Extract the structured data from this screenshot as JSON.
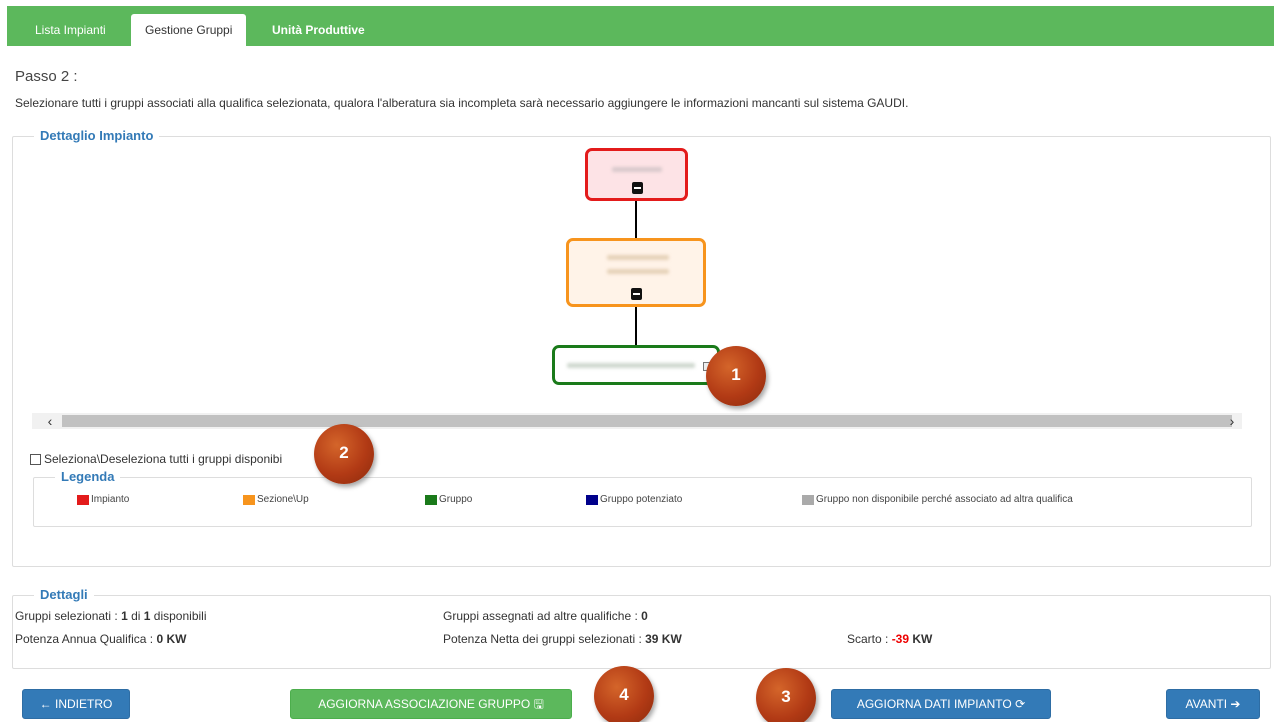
{
  "tabs": [
    {
      "label": "Lista Impianti"
    },
    {
      "label": "Gestione Gruppi"
    },
    {
      "label": "Unità Produttive"
    }
  ],
  "passo": "Passo 2 :",
  "instructions": "Selezionare tutti i gruppi associati alla qualifica selezionata, qualora l'alberatura sia incompleta sarà necessario aggiungere le informazioni mancanti sul sistema GAUDI.",
  "dettaglio_impianto": {
    "title": "Dettaglio Impianto"
  },
  "select_all": "Seleziona\\Deseleziona tutti i gruppi disponibi",
  "legenda": {
    "title": "Legenda",
    "items": [
      {
        "label": "Impianto",
        "color": "#e31b1b"
      },
      {
        "label": "Sezione\\Up",
        "color": "#f7941d"
      },
      {
        "label": "Gruppo",
        "color": "#1a7a1a"
      },
      {
        "label": "Gruppo potenziato",
        "color": "#00008b"
      },
      {
        "label": "Gruppo non disponibile perché associato ad altra qualifica",
        "color": "#aaaaaa"
      }
    ]
  },
  "dettagli": {
    "title": "Dettagli",
    "gruppi_selezionati_label": "Gruppi selezionati : ",
    "gruppi_selezionati_value": "1",
    "di": " di ",
    "disponibili_value": "1",
    "disponibili_label": " disponibili",
    "assegnati_label": "Gruppi assegnati ad altre qualifiche : ",
    "assegnati_value": "0",
    "potenza_annua_label": "Potenza Annua Qualifica : ",
    "potenza_annua_value": "0 KW",
    "potenza_netta_label": "Potenza Netta dei gruppi selezionati : ",
    "potenza_netta_value": "39 KW",
    "scarto_label": "Scarto : ",
    "scarto_value": "-39",
    "scarto_unit": " KW"
  },
  "buttons": {
    "indietro": "← INDIETRO",
    "aggiorna_associazione": "AGGIORNA ASSOCIAZIONE GRUPPO 🖫",
    "aggiorna_dati": "AGGIORNA DATI IMPIANTO ⟳",
    "avanti": "AVANTI ➔"
  },
  "markers": [
    "1",
    "2",
    "3",
    "4"
  ],
  "colors": {
    "nav_green": "#5cb85c",
    "primary_blue": "#337ab7",
    "impianto_border": "#e31b1b",
    "sezione_border": "#f7941d",
    "gruppo_border": "#1a7a1a"
  }
}
